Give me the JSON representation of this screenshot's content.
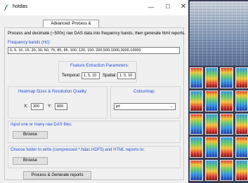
{
  "window": {
    "title": "hotdas",
    "minimize_glyph": "—",
    "maximize_glyph": "☐",
    "close_glyph": "✕"
  },
  "tab": {
    "label": "Advanced: Process & Display"
  },
  "intro_text": "Process and decimate (~500x) raw DAS data into frequency bands, then generate html reports.",
  "frequency_bands": {
    "label": "Frequency bands (Hz):",
    "value": "0, 5, 10, 15, 20, 30, 50, 75, 85, 95, 100, 120, 150, 200,500,1000,3000,10000"
  },
  "feature_extraction": {
    "title": "Feature Extraction Parameters:",
    "temporal_label": "Temporal:",
    "temporal_value": "1, 5, 10",
    "spatial_label": "Spatial:",
    "spatial_value": "1, 5, 10"
  },
  "heatmap": {
    "title": "Heatmap Sizes & Resolution Quality:",
    "x_label": "X:",
    "x_value": "300",
    "y_label": "Y:",
    "y_value": "800"
  },
  "colourmap": {
    "title": "Colourmap:",
    "selected": "jet"
  },
  "input_files": {
    "label": "Input one or many raw DAS files:",
    "browse_label": "Browse"
  },
  "output_folder": {
    "label": "Choose folder to write (compressed *.hdas.HDF5) and HTML reports to:",
    "browse_label": "Browse"
  },
  "process_button": {
    "label": "Process & Generate reports"
  },
  "colors": {
    "accent_text": "#1f4fd6",
    "dialog_bg": "#f0f0f0",
    "preview_bg": "#3a3c52"
  },
  "icons": {
    "app": "feather-icon",
    "dropdown": "chevron-down-icon"
  }
}
